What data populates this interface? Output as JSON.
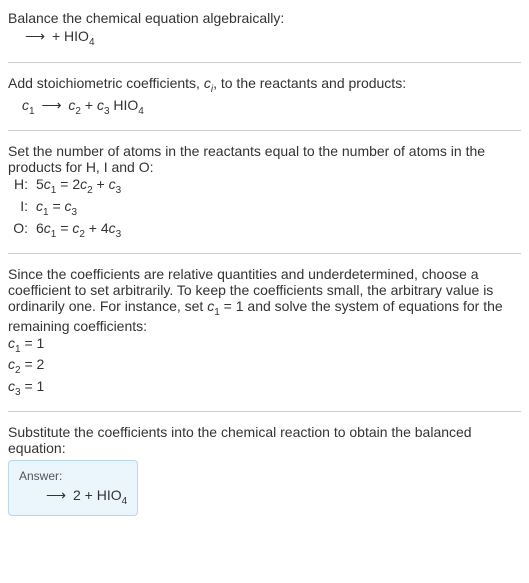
{
  "s1": {
    "line1": "Balance the chemical equation algebraically:",
    "arrow": "⟶",
    "plus": " + HIO",
    "sub4": "4"
  },
  "s2": {
    "line1_a": "Add stoichiometric coefficients, ",
    "ci_c": "c",
    "ci_i": "i",
    "line1_b": ", to the reactants and products:",
    "c1_c": "c",
    "c1_1": "1",
    "arrow": "⟶",
    "c2_c": "c",
    "c2_2": "2",
    "plus": " + ",
    "c3_c": "c",
    "c3_3": "3",
    "hio": " HIO",
    "sub4": "4"
  },
  "s3": {
    "intro": "Set the number of atoms in the reactants equal to the number of atoms in the products for H, I and O:",
    "rows": [
      {
        "label": "H:",
        "lhs_coef": "5",
        "lhs_c": "c",
        "lhs_sub": "1",
        "eq": " = 2",
        "r1_c": "c",
        "r1_sub": "2",
        "plus": " + ",
        "r2_c": "c",
        "r2_sub": "3"
      },
      {
        "label": "I:",
        "lhs_coef": "",
        "lhs_c": "c",
        "lhs_sub": "1",
        "eq": " = ",
        "r1_c": "c",
        "r1_sub": "3",
        "plus": "",
        "r2_c": "",
        "r2_sub": ""
      },
      {
        "label": "O:",
        "lhs_coef": "6",
        "lhs_c": "c",
        "lhs_sub": "1",
        "eq": " = ",
        "r1_c": "c",
        "r1_sub": "2",
        "plus": " + 4",
        "r2_c": "c",
        "r2_sub": "3"
      }
    ]
  },
  "s4": {
    "para_a": "Since the coefficients are relative quantities and underdetermined, choose a coefficient to set arbitrarily. To keep the coefficients small, the arbitrary value is ordinarily one. For instance, set ",
    "c": "c",
    "one": "1",
    "para_b": " = 1 and solve the system of equations for the remaining coefficients:",
    "lines": [
      {
        "c": "c",
        "sub": "1",
        "val": " = 1"
      },
      {
        "c": "c",
        "sub": "2",
        "val": " = 2"
      },
      {
        "c": "c",
        "sub": "3",
        "val": " = 1"
      }
    ]
  },
  "s5": {
    "intro": "Substitute the coefficients into the chemical reaction to obtain the balanced equation:",
    "answer_label": "Answer:",
    "arrow": "⟶",
    "two": " 2 ",
    "plus": " + HIO",
    "sub4": "4"
  }
}
